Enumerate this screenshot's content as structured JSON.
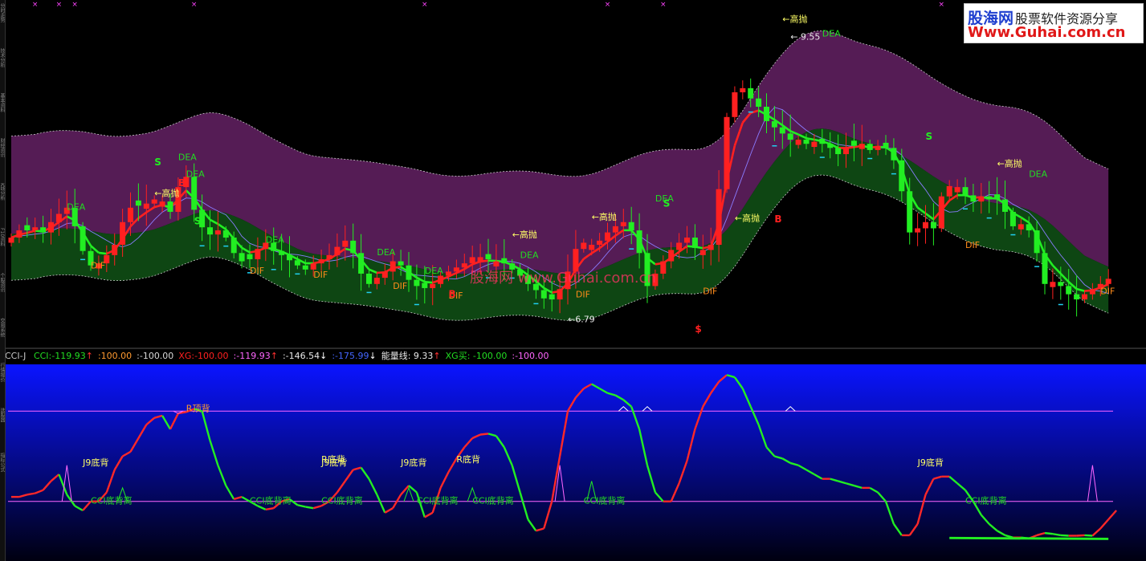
{
  "logo": {
    "brand": "股海网",
    "slogan": "股票软件资源分享",
    "url": "Www.Guhai.com.cn"
  },
  "side_labels": [
    "分时走势",
    "技术分析",
    "基本资料",
    "财经资讯",
    "K线分析",
    "F10资料",
    "个股资讯",
    "交易系统",
    "行情报价",
    "选股器",
    "指标公式"
  ],
  "watermark": "股海网  www.Guhai.com.cn",
  "indicator_header": {
    "name": "CCI-J",
    "items": [
      {
        "text": "CCI:-119.93",
        "arrow": "↑",
        "color": "#22dd22",
        "arrow_color": "#ff3030"
      },
      {
        "text": ":100.00",
        "arrow": "",
        "color": "#ff9a30",
        "arrow_color": ""
      },
      {
        "text": ":-100.00",
        "arrow": "",
        "color": "#d8d8d8",
        "arrow_color": ""
      },
      {
        "text": "XG:-100.00",
        "arrow": "",
        "color": "#ff2020",
        "arrow_color": ""
      },
      {
        "text": ":-119.93",
        "arrow": "↑",
        "color": "#ff66ff",
        "arrow_color": "#ff3030"
      },
      {
        "text": ":-146.54",
        "arrow": "↓",
        "color": "#e8e8e8",
        "arrow_color": "#ffffff"
      },
      {
        "text": ":-175.99",
        "arrow": "↓",
        "color": "#4466ff",
        "arrow_color": "#ffffff"
      },
      {
        "text": "能量线: 9.33",
        "arrow": "↑",
        "color": "#e8e8e8",
        "arrow_color": "#ff3030"
      },
      {
        "text": "XG买: -100.00",
        "arrow": "",
        "color": "#22dd22",
        "arrow_color": ""
      },
      {
        "text": ":-100.00",
        "arrow": "",
        "color": "#ff66ff",
        "arrow_color": ""
      }
    ]
  },
  "colors": {
    "up": "#ff2020",
    "down": "#22ee22",
    "upper_band": "#5a1e5a",
    "lower_band": "#0f4a14",
    "band_edge": "#c8c8c8",
    "dif": "#ff8c1a",
    "dea_label": "#22dd22",
    "note_yellow": "#ffff66",
    "cci_up": "#ff2828",
    "cci_down": "#22ee22",
    "ref_line": "#ff66ff"
  },
  "chart_data": [
    {
      "type": "candlestick",
      "x": [
        0,
        1,
        2,
        3,
        4,
        5,
        6,
        7,
        8,
        9,
        10,
        11,
        12,
        13,
        14,
        15,
        16,
        17,
        18,
        19,
        20,
        21,
        22,
        23,
        24,
        25,
        26,
        27,
        28,
        29,
        30,
        31,
        32,
        33,
        34,
        35,
        36,
        37,
        38,
        39,
        40,
        41,
        42,
        43,
        44,
        45,
        46,
        47,
        48,
        49,
        50,
        51,
        52,
        53,
        54,
        55,
        56,
        57,
        58,
        59,
        60,
        61,
        62,
        63,
        64,
        65,
        66,
        67,
        68,
        69,
        70,
        71,
        72,
        73,
        74,
        75,
        76,
        77,
        78,
        79,
        80,
        81,
        82,
        83,
        84,
        85,
        86,
        87,
        88,
        89,
        90,
        91,
        92,
        93,
        94,
        95,
        96,
        97,
        98,
        99,
        100,
        101,
        102,
        103,
        104,
        105,
        106,
        107,
        108,
        109,
        110,
        111,
        112,
        113,
        114,
        115,
        116,
        117,
        118,
        119,
        120,
        121,
        122,
        123,
        124,
        125,
        126,
        127,
        128,
        129,
        130,
        131,
        132,
        133,
        134,
        135,
        136,
        137,
        138
      ],
      "close": [
        7.55,
        7.62,
        7.62,
        7.65,
        7.6,
        7.7,
        7.78,
        7.84,
        7.66,
        7.42,
        7.28,
        7.3,
        7.38,
        7.48,
        7.7,
        7.84,
        7.86,
        7.88,
        7.92,
        7.9,
        7.8,
        8.04,
        8.14,
        7.82,
        7.65,
        7.58,
        7.62,
        7.55,
        7.4,
        7.32,
        7.34,
        7.44,
        7.5,
        7.42,
        7.38,
        7.33,
        7.28,
        7.24,
        7.3,
        7.34,
        7.38,
        7.46,
        7.52,
        7.4,
        7.2,
        7.1,
        7.16,
        7.22,
        7.32,
        7.28,
        7.14,
        7.08,
        7.06,
        7.1,
        7.18,
        7.22,
        7.26,
        7.3,
        7.36,
        7.36,
        7.34,
        7.32,
        7.3,
        7.24,
        7.18,
        7.1,
        7.04,
        6.96,
        6.95,
        7.05,
        7.22,
        7.44,
        7.5,
        7.48,
        7.52,
        7.6,
        7.66,
        7.7,
        7.62,
        7.4,
        7.08,
        7.2,
        7.32,
        7.43,
        7.5,
        7.55,
        7.45,
        7.43,
        7.48,
        8.02,
        8.72,
        8.96,
        9.0,
        8.9,
        8.82,
        8.68,
        8.62,
        8.56,
        8.5,
        8.5,
        8.46,
        8.48,
        8.46,
        8.42,
        8.36,
        8.42,
        8.44,
        8.46,
        8.4,
        8.44,
        8.42,
        8.3,
        8.0,
        7.6,
        7.64,
        7.7,
        7.64,
        7.95,
        8.05,
        8.04,
        7.96,
        7.9,
        7.95,
        7.92,
        7.92,
        7.8,
        7.66,
        7.68,
        7.62,
        7.4,
        7.1,
        7.12,
        7.08,
        7.0,
        6.95,
        7.0,
        7.05,
        7.1,
        7.15
      ],
      "annotations": [
        {
          "text": "←高抛",
          "color": "#ffff66"
        },
        {
          "text": "←高抛",
          "color": "#ffff66"
        },
        {
          "text": "←高抛",
          "color": "#ffff66"
        },
        {
          "text": "←高抛",
          "color": "#ffff66"
        },
        {
          "text": "←高抛",
          "color": "#ffff66"
        },
        {
          "text": "←高抛",
          "color": "#ffff66"
        },
        {
          "text": "← 9.55",
          "color": "#e8e8e8"
        },
        {
          "text": "←6.79",
          "color": "#e8e8e8"
        },
        {
          "text": "DEA",
          "color": "#22dd22"
        },
        {
          "text": "DEA",
          "color": "#22dd22"
        },
        {
          "text": "DEA",
          "color": "#22dd22"
        },
        {
          "text": "DEA",
          "color": "#22dd22"
        },
        {
          "text": "DEA",
          "color": "#22dd22"
        },
        {
          "text": "DEA",
          "color": "#22dd22"
        },
        {
          "text": "DEA",
          "color": "#22dd22"
        },
        {
          "text": "DEA",
          "color": "#22dd22"
        },
        {
          "text": "DEA",
          "color": "#22dd22"
        },
        {
          "text": "DEA",
          "color": "#22dd22"
        },
        {
          "text": "DIF",
          "color": "#ff8c1a"
        },
        {
          "text": "DIF",
          "color": "#ff8c1a"
        },
        {
          "text": "DIF",
          "color": "#ff8c1a"
        },
        {
          "text": "DIF",
          "color": "#ff8c1a"
        },
        {
          "text": "DIF",
          "color": "#ff8c1a"
        },
        {
          "text": "DIF",
          "color": "#ff8c1a"
        },
        {
          "text": "DIF",
          "color": "#ff8c1a"
        },
        {
          "text": "DIF",
          "color": "#ff8c1a"
        },
        {
          "text": "DIF",
          "color": "#ff8c1a"
        },
        {
          "text": "S",
          "color": "#22ee22"
        },
        {
          "text": "S",
          "color": "#22ee22"
        },
        {
          "text": "S",
          "color": "#22ee22"
        },
        {
          "text": "S",
          "color": "#22ee22"
        },
        {
          "text": "B",
          "color": "#ff2020"
        },
        {
          "text": "B",
          "color": "#ff2020"
        },
        {
          "text": "B",
          "color": "#ff2020"
        },
        {
          "text": "$",
          "color": "#ff2020"
        }
      ]
    },
    {
      "type": "line",
      "x": [
        0,
        1,
        2,
        3,
        4,
        5,
        6,
        7,
        8,
        9,
        10,
        11,
        12,
        13,
        14,
        15,
        16,
        17,
        18,
        19,
        20,
        21,
        22,
        23,
        24,
        25,
        26,
        27,
        28,
        29,
        30,
        31,
        32,
        33,
        34,
        35,
        36,
        37,
        38,
        39,
        40,
        41,
        42,
        43,
        44,
        45,
        46,
        47,
        48,
        49,
        50,
        51,
        52,
        53,
        54,
        55,
        56,
        57,
        58,
        59,
        60,
        61,
        62,
        63,
        64,
        65,
        66,
        67,
        68,
        69,
        70,
        71,
        72,
        73,
        74,
        75,
        76,
        77,
        78,
        79,
        80,
        81,
        82,
        83,
        84,
        85,
        86,
        87,
        88,
        89,
        90,
        91,
        92,
        93,
        94,
        95,
        96,
        97,
        98,
        99,
        100,
        101,
        102,
        103,
        104,
        105,
        106,
        107,
        108,
        109,
        110,
        111,
        112,
        113,
        114,
        115,
        116,
        117,
        118,
        119,
        120,
        121,
        122,
        123,
        124,
        125,
        126,
        127,
        128,
        129,
        130,
        131,
        132,
        133,
        134,
        135,
        136,
        137,
        138
      ],
      "series": [
        {
          "name": "CCI",
          "values": [
            -90,
            -90,
            -85,
            -82,
            -75,
            -55,
            -40,
            -85,
            -110,
            -120,
            -100,
            -100,
            -80,
            -30,
            0,
            10,
            40,
            70,
            85,
            90,
            60,
            95,
            98,
            105,
            100,
            35,
            -20,
            -65,
            -95,
            -90,
            -100,
            -110,
            -118,
            -115,
            -100,
            -95,
            -108,
            -112,
            -115,
            -110,
            -100,
            -80,
            -55,
            -30,
            -25,
            -50,
            -85,
            -125,
            -115,
            -85,
            -65,
            -80,
            -135,
            -125,
            -70,
            -35,
            -5,
            20,
            40,
            48,
            50,
            45,
            20,
            -20,
            -80,
            -140,
            -165,
            -160,
            -100,
            0,
            100,
            130,
            150,
            160,
            150,
            140,
            135,
            125,
            110,
            60,
            -20,
            -80,
            -100,
            -100,
            -60,
            -10,
            60,
            110,
            140,
            165,
            180,
            175,
            150,
            110,
            70,
            20,
            0,
            -5,
            -15,
            -20,
            -30,
            -40,
            -50,
            -50,
            -55,
            -60,
            -65,
            -70,
            -70,
            -80,
            -100,
            -150,
            -175,
            -175,
            -150,
            -85,
            -50,
            -45,
            -45,
            -60,
            -75,
            -100,
            -130,
            -150,
            -165,
            -175,
            -180,
            -180,
            -182,
            -175,
            -170,
            -172,
            -175,
            -176,
            -176,
            -175,
            -176,
            -160,
            -140,
            -120
          ]
        }
      ],
      "reference_lines": [
        100,
        -100
      ],
      "annotations": [
        {
          "text": "R顶背",
          "color": "#ff9a30"
        },
        {
          "text": "J9底背",
          "color": "#ffff66"
        },
        {
          "text": "J9底背",
          "color": "#ffff66"
        },
        {
          "text": "J9底背",
          "color": "#ffff66"
        },
        {
          "text": "J9底背",
          "color": "#ffff66"
        },
        {
          "text": "R底背",
          "color": "#ffff66"
        },
        {
          "text": "R底背",
          "color": "#ffff66"
        },
        {
          "text": "CCI底背离",
          "color": "#22dd22"
        },
        {
          "text": "CCI底背离",
          "color": "#22dd22"
        },
        {
          "text": "CCI底背离",
          "color": "#22dd22"
        },
        {
          "text": "CCI底背离",
          "color": "#22dd22"
        },
        {
          "text": "CCI底背离",
          "color": "#22dd22"
        },
        {
          "text": "CCI底背离",
          "color": "#22dd22"
        },
        {
          "text": "CCI底背离",
          "color": "#22dd22"
        }
      ]
    }
  ]
}
